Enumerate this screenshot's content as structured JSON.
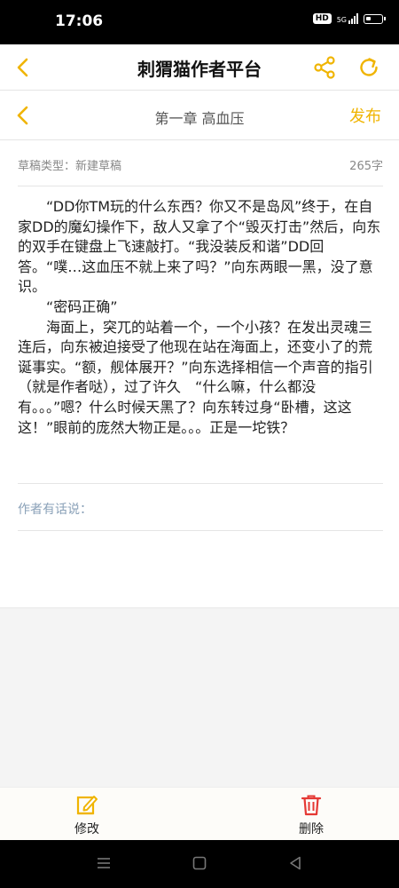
{
  "status_bar": {
    "time": "17:06",
    "hd": "HD",
    "network": "5G"
  },
  "header": {
    "title": "刺猬猫作者平台",
    "icons": [
      "back-chevron-icon",
      "share-icon",
      "refresh-icon"
    ],
    "accent_color": "#f0b400"
  },
  "subheader": {
    "chapter_title": "第一章 高血压",
    "publish_label": "发布"
  },
  "draft": {
    "type_label": "草稿类型：新建草稿",
    "word_count": "265字"
  },
  "content": {
    "paragraphs": [
      "“DD你TM玩的什么东西？你又不是岛风”终于，在自家DD的魔幻操作下，敌人又拿了个“毁灭打击”然后，向东的双手在键盘上飞速敲打。“我没装反和谐”DD回答。“噗…这血压不就上来了吗？”向东两眼一黑，没了意识。",
      "“密码正确”",
      "海面上，突兀的站着一个，一个小孩？在发出灵魂三连后，向东被迫接受了他现在站在海面上，还变小了的荒诞事实。“额，舰体展开？”向东选择相信一个声音的指引（就是作者哒），过了许久　“什么嘛，什么都没有。。。”嗯？什么时候天黑了？向东转过身“卧槽，这这这！”眼前的庞然大物正是。。。正是一坨铁？"
    ]
  },
  "author_note": {
    "label": "作者有话说："
  },
  "toolbar": {
    "edit_label": "修改",
    "edit_icon": "edit-icon",
    "edit_color": "#f0b400",
    "delete_label": "删除",
    "delete_icon": "trash-icon",
    "delete_color": "#e53935"
  },
  "nav": {
    "icons": [
      "menu-icon",
      "home-icon",
      "back-icon"
    ]
  }
}
